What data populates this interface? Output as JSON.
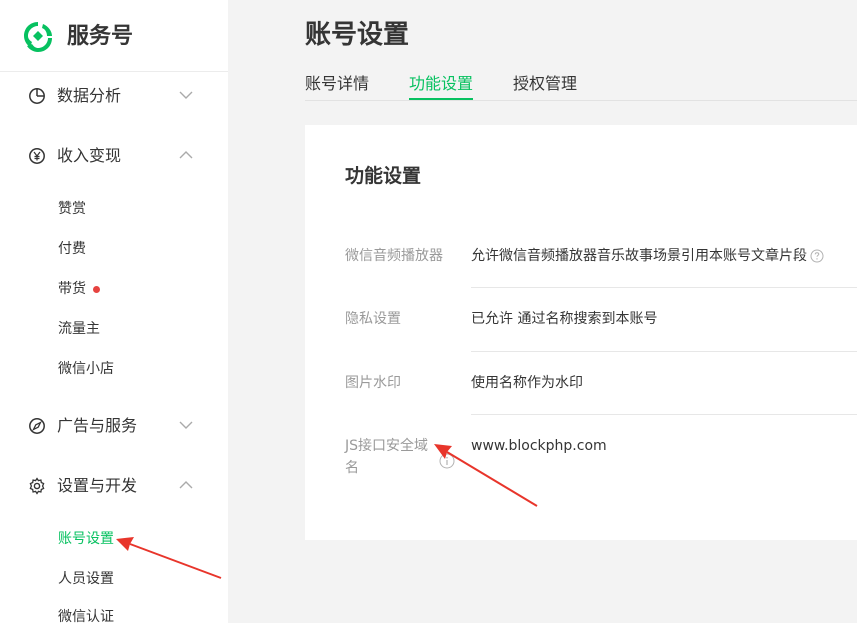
{
  "brand": {
    "name": "服务号",
    "logo_icon": "wechat-mp-logo-icon",
    "accent": "#07c160"
  },
  "sidebar": {
    "groups": [
      {
        "label": "数据分析",
        "icon": "chart-pie-icon",
        "expanded": false
      },
      {
        "label": "收入变现",
        "icon": "yen-coin-icon",
        "expanded": true,
        "items": [
          "赞赏",
          "付费",
          "带货",
          "流量主",
          "微信小店"
        ]
      },
      {
        "label": "广告与服务",
        "icon": "compass-icon",
        "expanded": false
      },
      {
        "label": "设置与开发",
        "icon": "gear-icon",
        "expanded": true,
        "items": [
          "账号设置",
          "人员设置",
          "微信认证"
        ]
      }
    ],
    "active_item": "账号设置",
    "badge_item": "带货"
  },
  "main": {
    "title": "账号设置",
    "tabs": [
      {
        "label": "账号详情",
        "active": false
      },
      {
        "label": "功能设置",
        "active": true
      },
      {
        "label": "授权管理",
        "active": false
      }
    ],
    "card": {
      "title": "功能设置",
      "rows": [
        {
          "label": "微信音频播放器",
          "value": "允许微信音频播放器音乐故事场景引用本账号文章片段",
          "value_help_icon": "question-circle-icon"
        },
        {
          "label": "隐私设置",
          "value": "已允许 通过名称搜索到本账号"
        },
        {
          "label": "图片水印",
          "value": "使用名称作为水印"
        },
        {
          "label": "JS接口安全域名",
          "value": "www.blockphp.com",
          "label_help_icon": "info-circle-icon"
        }
      ]
    }
  },
  "annotations": {
    "arrow_color": "#e8352b"
  }
}
